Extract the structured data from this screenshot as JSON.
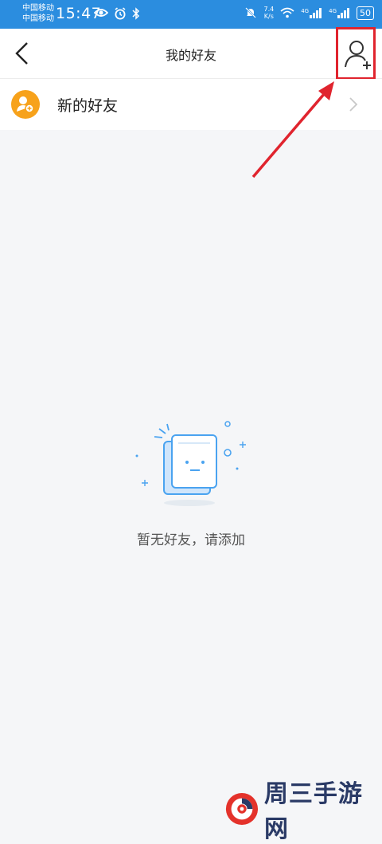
{
  "status_bar": {
    "carrier_1": "中国移动",
    "carrier_2": "中国移动",
    "time": "15:47",
    "net_speed_value": "7.4",
    "net_speed_unit": "K/s",
    "signal_1_label": "4G",
    "signal_2_label": "4G",
    "battery": "50"
  },
  "header": {
    "title": "我的好友",
    "back_icon": "chevron-left-icon",
    "add_friend_icon": "add-user-icon"
  },
  "new_friends": {
    "label": "新的好友",
    "icon": "friend-request-icon",
    "accent_color": "#f7a21b"
  },
  "empty_state": {
    "message": "暂无好友，请添加",
    "illustration": "empty-box-face-icon"
  },
  "annotation": {
    "color": "#e0242e"
  },
  "watermark": {
    "text": "周三手游网",
    "logo": "swirl-logo-icon"
  },
  "colors": {
    "status_bar": "#2b8ddf",
    "background": "#f5f6f8",
    "illustration_blue": "#4aa3f0"
  }
}
